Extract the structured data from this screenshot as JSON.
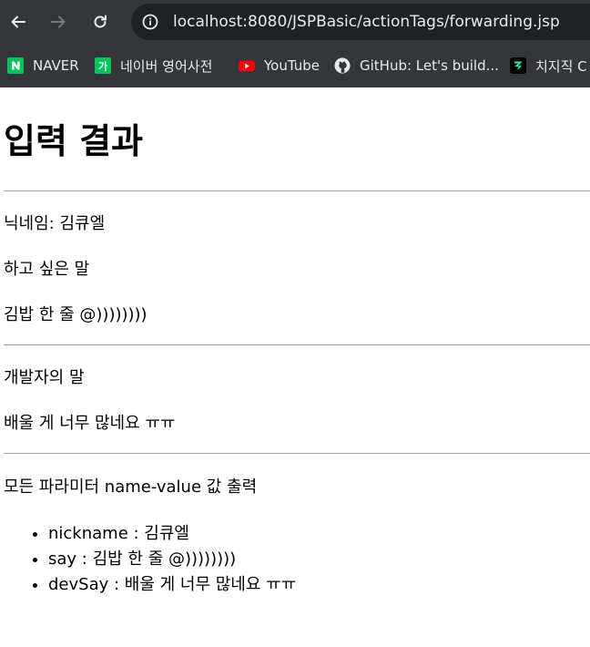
{
  "browser": {
    "url_host": "localhost:8080",
    "url_path": "/JSPBasic/actionTags/forwarding.jsp",
    "bookmarks": [
      {
        "label": "NAVER",
        "icon": "naver-icon"
      },
      {
        "label": "네이버 영어사전",
        "icon": "naver-dictionary-icon"
      },
      {
        "label": "YouTube",
        "icon": "youtube-icon"
      },
      {
        "label": "GitHub: Let's build...",
        "icon": "github-icon"
      },
      {
        "label": "치지직 C",
        "icon": "chzzk-icon"
      }
    ]
  },
  "page": {
    "title": "입력 결과",
    "nickname_line": "닉네임: 김큐엘",
    "say_heading": "하고 싶은 말",
    "say_value": "김밥 한 줄 @))))))))",
    "dev_heading": "개발자의 말",
    "dev_value": "배울 게 너무 많네요 ㅠㅠ",
    "params_heading": "모든 파라미터 name-value 값 출력",
    "params": [
      "nickname : 김큐엘",
      "say : 김밥 한 줄 @))))))))",
      "devSay : 배울 게 너무 많네요 ㅠㅠ"
    ]
  },
  "colors": {
    "chrome_bg": "#35363a",
    "omnibox_bg": "#202124",
    "naver_green": "#03c75a",
    "youtube_red": "#ff0000"
  }
}
